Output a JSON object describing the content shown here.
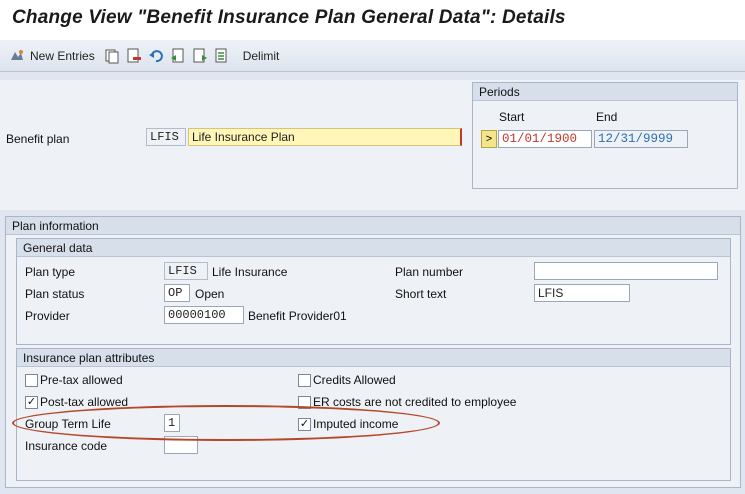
{
  "title": "Change View \"Benefit Insurance Plan General Data\": Details",
  "toolbar": {
    "new_entries": "New Entries",
    "delimit": "Delimit"
  },
  "header": {
    "benefit_plan_label": "Benefit plan",
    "benefit_plan_code": "LFIS",
    "benefit_plan_name": "Life Insurance Plan",
    "periods": {
      "title": "Periods",
      "start_label": "Start",
      "end_label": "End",
      "arrow": ">",
      "start": "01/01/1900",
      "end": "12/31/9999"
    }
  },
  "plan_information": {
    "title": "Plan information",
    "general_data": {
      "title": "General data",
      "plan_type_label": "Plan type",
      "plan_type_code": "LFIS",
      "plan_type_text": "Life Insurance",
      "plan_status_label": "Plan status",
      "plan_status_code": "OP",
      "plan_status_text": "Open",
      "provider_label": "Provider",
      "provider_code": "00000100",
      "provider_text": "Benefit Provider01",
      "plan_number_label": "Plan number",
      "plan_number_value": "",
      "short_text_label": "Short text",
      "short_text_value": "LFIS"
    },
    "insurance_attributes": {
      "title": "Insurance plan attributes",
      "pre_tax_label": "Pre-tax allowed",
      "post_tax_label": "Post-tax allowed",
      "credits_label": "Credits Allowed",
      "er_costs_label": "ER costs are not credited to employee",
      "group_term_life_label": "Group Term Life",
      "group_term_life_value": "1",
      "imputed_income_label": "Imputed income",
      "insurance_code_label": "Insurance code",
      "insurance_code_value": "",
      "checks": {
        "pre_tax": false,
        "post_tax": true,
        "credits": false,
        "er_costs": false,
        "imputed_income": true
      }
    }
  },
  "colors": {
    "highlight_ring": "#b5482a",
    "date_red": "#c0392b",
    "date_blue": "#2d6fb5"
  }
}
